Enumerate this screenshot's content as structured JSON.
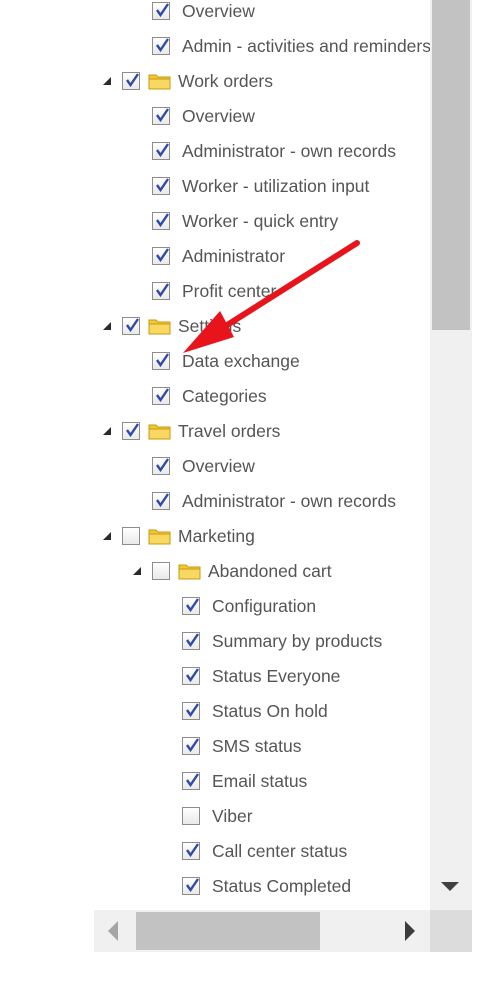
{
  "tree": {
    "items": [
      {
        "label": "Overview",
        "checked": true,
        "folder": false
      },
      {
        "label": "Admin - activities and reminders",
        "checked": true,
        "folder": false
      },
      {
        "label": "Work orders",
        "checked": true,
        "folder": true
      },
      {
        "label": "Overview",
        "checked": true,
        "folder": false
      },
      {
        "label": "Administrator - own records",
        "checked": true,
        "folder": false
      },
      {
        "label": "Worker - utilization input",
        "checked": true,
        "folder": false
      },
      {
        "label": "Worker - quick entry",
        "checked": true,
        "folder": false
      },
      {
        "label": "Administrator",
        "checked": true,
        "folder": false
      },
      {
        "label": "Profit center",
        "checked": true,
        "folder": false
      },
      {
        "label": "Settings",
        "checked": true,
        "folder": true
      },
      {
        "label": "Data exchange",
        "checked": true,
        "folder": false
      },
      {
        "label": "Categories",
        "checked": true,
        "folder": false
      },
      {
        "label": "Travel orders",
        "checked": true,
        "folder": true
      },
      {
        "label": "Overview",
        "checked": true,
        "folder": false
      },
      {
        "label": "Administrator - own records",
        "checked": true,
        "folder": false
      },
      {
        "label": "Marketing",
        "checked": false,
        "folder": true
      },
      {
        "label": "Abandoned cart",
        "checked": false,
        "folder": true
      },
      {
        "label": "Configuration",
        "checked": true,
        "folder": false
      },
      {
        "label": "Summary by products",
        "checked": true,
        "folder": false
      },
      {
        "label": "Status Everyone",
        "checked": true,
        "folder": false
      },
      {
        "label": "Status On hold",
        "checked": true,
        "folder": false
      },
      {
        "label": "SMS status",
        "checked": true,
        "folder": false
      },
      {
        "label": "Email status",
        "checked": true,
        "folder": false
      },
      {
        "label": "Viber",
        "checked": false,
        "folder": false
      },
      {
        "label": "Call center status",
        "checked": true,
        "folder": false
      },
      {
        "label": "Status Completed",
        "checked": true,
        "folder": false
      }
    ]
  },
  "colors": {
    "annotation_arrow": "#e8141b",
    "checkmark": "#2f4aa8",
    "folder": "#f3c838"
  }
}
